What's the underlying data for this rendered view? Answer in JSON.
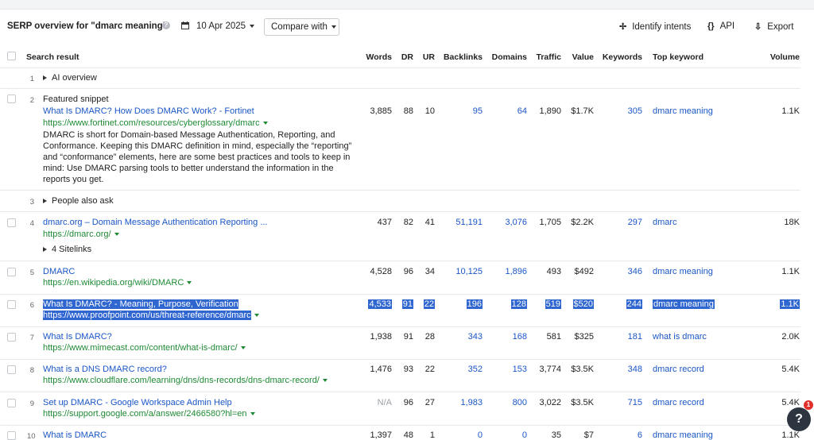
{
  "toolbar": {
    "title": "SERP overview for \"dmarc meaning\"",
    "date": "10 Apr 2025",
    "compare_label": "Compare with",
    "identify_label": "Identify intents",
    "api_label": "API",
    "export_label": "Export"
  },
  "columns": {
    "search_result": "Search result",
    "words": "Words",
    "dr": "DR",
    "ur": "UR",
    "backlinks": "Backlinks",
    "domains": "Domains",
    "traffic": "Traffic",
    "value": "Value",
    "keywords": "Keywords",
    "top_keyword": "Top keyword",
    "volume": "Volume"
  },
  "rows": [
    {
      "rank": "1",
      "label": "AI overview"
    },
    {
      "rank": "2",
      "label": "Featured snippet",
      "title": "What Is DMARC? How Does DMARC Work? - Fortinet",
      "url": "https://www.fortinet.com/resources/cyberglossary/dmarc",
      "snippet": "DMARC is short for Domain-based Message Authentication, Reporting, and Conformance. Keeping this DMARC definition in mind, especially the “reporting” and “conformance” elements, here are some best practices and tools to keep in mind: Use DMARC parsing tools to better understand the information in the reports you get.",
      "words": "3,885",
      "dr": "88",
      "ur": "10",
      "backlinks": "95",
      "domains": "64",
      "traffic": "1,890",
      "value": "$1.7K",
      "keywords": "305",
      "top_keyword": "dmarc meaning",
      "volume": "1.1K"
    },
    {
      "rank": "3",
      "label": "People also ask"
    },
    {
      "rank": "4",
      "title": "dmarc.org – Domain Message Authentication Reporting ...",
      "url": "https://dmarc.org/",
      "sitelinks": "4 Sitelinks",
      "words": "437",
      "dr": "82",
      "ur": "41",
      "backlinks": "51,191",
      "domains": "3,076",
      "traffic": "1,705",
      "value": "$2.2K",
      "keywords": "297",
      "top_keyword": "dmarc",
      "volume": "18K"
    },
    {
      "rank": "5",
      "title": "DMARC",
      "url": "https://en.wikipedia.org/wiki/DMARC",
      "words": "4,528",
      "dr": "96",
      "ur": "34",
      "backlinks": "10,125",
      "domains": "1,896",
      "traffic": "493",
      "value": "$492",
      "keywords": "346",
      "top_keyword": "dmarc meaning",
      "volume": "1.1K"
    },
    {
      "rank": "6",
      "title": "What Is DMARC? - Meaning, Purpose, Verification",
      "url": "https://www.proofpoint.com/us/threat-reference/dmarc",
      "words": "4,533",
      "dr": "91",
      "ur": "22",
      "backlinks": "196",
      "domains": "128",
      "traffic": "519",
      "value": "$520",
      "keywords": "244",
      "top_keyword": "dmarc meaning",
      "volume": "1.1K"
    },
    {
      "rank": "7",
      "title": "What Is DMARC?",
      "url": "https://www.mimecast.com/content/what-is-dmarc/",
      "words": "1,938",
      "dr": "91",
      "ur": "28",
      "backlinks": "343",
      "domains": "168",
      "traffic": "581",
      "value": "$325",
      "keywords": "181",
      "top_keyword": "what is dmarc",
      "volume": "2.0K"
    },
    {
      "rank": "8",
      "title": "What is a DNS DMARC record?",
      "url": "https://www.cloudflare.com/learning/dns/dns-records/dns-dmarc-record/",
      "words": "1,476",
      "dr": "93",
      "ur": "22",
      "backlinks": "352",
      "domains": "153",
      "traffic": "3,774",
      "value": "$3.5K",
      "keywords": "348",
      "top_keyword": "dmarc record",
      "volume": "5.4K"
    },
    {
      "rank": "9",
      "title": "Set up DMARC - Google Workspace Admin Help",
      "url": "https://support.google.com/a/answer/2466580?hl=en",
      "words": "N/A",
      "dr": "96",
      "ur": "27",
      "backlinks": "1,983",
      "domains": "800",
      "traffic": "3,022",
      "value": "$3.5K",
      "keywords": "715",
      "top_keyword": "dmarc record",
      "volume": "5.4K"
    },
    {
      "rank": "10",
      "title": "What is DMARC",
      "words": "1,397",
      "dr": "48",
      "ur": "1",
      "backlinks": "0",
      "domains": "0",
      "traffic": "35",
      "value": "$7",
      "keywords": "6",
      "top_keyword": "dmarc meaning",
      "volume": "1.1K"
    }
  ],
  "help_widget": {
    "icon": "?",
    "badge": "1"
  }
}
